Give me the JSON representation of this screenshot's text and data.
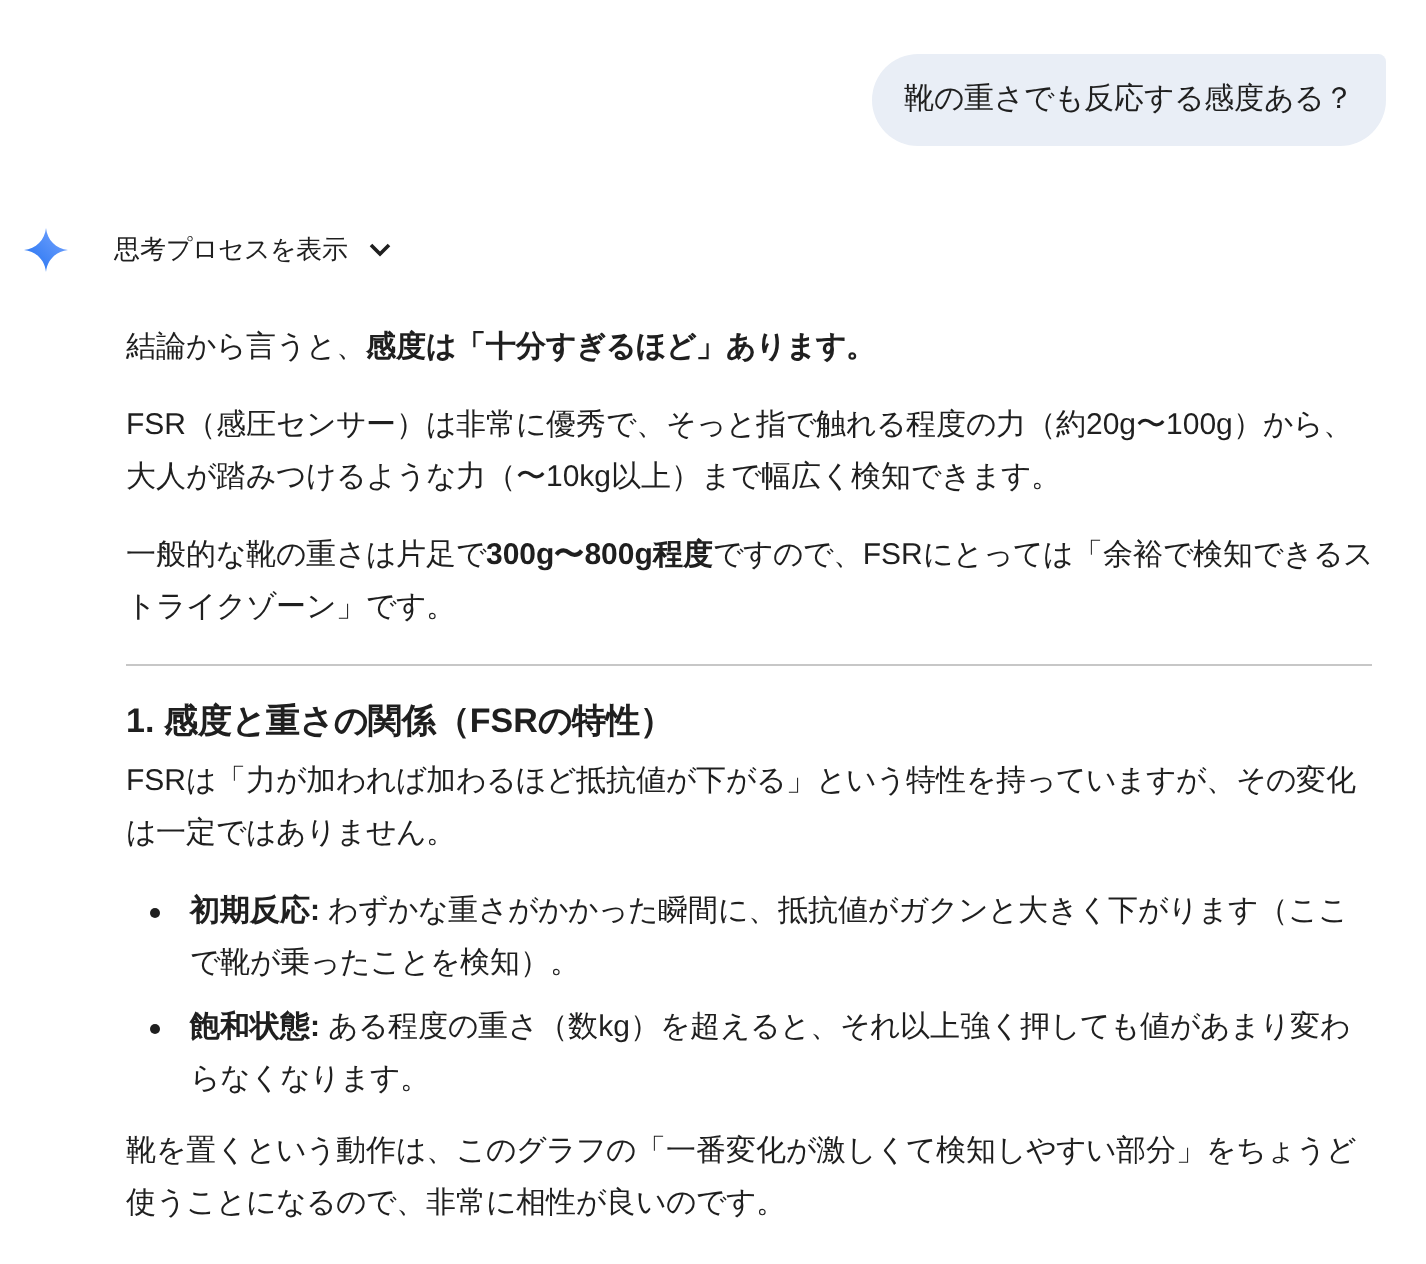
{
  "user_message": {
    "text": "靴の重さでも反応する感度ある？"
  },
  "response": {
    "thinking_toggle": {
      "label": "思考プロセスを表示",
      "expanded": false
    },
    "blocks": [
      {
        "kind": "paragraph",
        "text": "結論から言うと、**感度は「十分すぎるほど」あります。**"
      },
      {
        "kind": "paragraph",
        "text": "FSR（感圧センサー）は非常に優秀で、そっと指で触れる程度の力（約20g〜100g）から、大人が踏みつけるような力（〜10kg以上）まで幅広く検知できます。"
      },
      {
        "kind": "paragraph",
        "text": "一般的な靴の重さは片足で**300g〜800g程度**ですので、FSRにとっては「余裕で検知できるストライクゾーン」です。"
      },
      {
        "kind": "rule"
      },
      {
        "kind": "heading",
        "text": "1. 感度と重さの関係（FSRの特性）"
      },
      {
        "kind": "paragraph",
        "text": "FSRは「力が加われば加わるほど抵抗値が下がる」という特性を持っていますが、その変化は一定ではありません。"
      },
      {
        "kind": "list",
        "items": [
          "**初期反応:** わずかな重さがかかった瞬間に、抵抗値がガクンと大きく下がります（ここで靴が乗ったことを検知）。",
          "**飽和状態:** ある程度の重さ（数kg）を超えると、それ以上強く押しても値があまり変わらなくなります。"
        ]
      },
      {
        "kind": "paragraph",
        "text": "靴を置くという動作は、このグラフの「一番変化が激しくて検知しやすい部分」をちょうど使うことになるので、非常に相性が良いのです。"
      }
    ]
  }
}
